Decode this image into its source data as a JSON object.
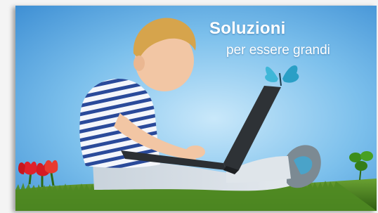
{
  "banner": {
    "headline": "Soluzioni",
    "subline": "per essere grandi"
  },
  "colors": {
    "sky_top": "#2d86cf",
    "sky_bottom": "#bfe1f7",
    "grass": "#3f7d1e",
    "shirt_stripe": "#2a4a9a",
    "butterfly": "#3fb7d8",
    "tulip": "#e0212a"
  },
  "icons": {
    "butterfly": "butterfly-icon",
    "clover": "clover-icon",
    "tulips": "tulip-flowers"
  }
}
